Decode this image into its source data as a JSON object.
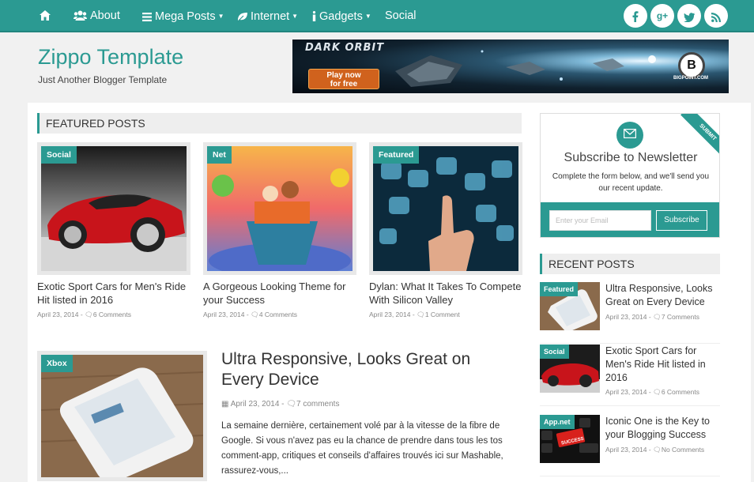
{
  "nav": {
    "items": [
      {
        "label": "About",
        "icon": "users-icon"
      },
      {
        "label": "Mega Posts",
        "icon": "list-icon"
      },
      {
        "label": "Internet",
        "icon": "leaf-icon"
      },
      {
        "label": "Gadgets",
        "icon": "info-icon"
      },
      {
        "label": "Social",
        "icon": ""
      }
    ],
    "social": [
      "facebook-icon",
      "google-plus-icon",
      "twitter-icon",
      "rss-icon"
    ]
  },
  "header": {
    "title": "Zippo Template",
    "tagline": "Just Another Blogger Template"
  },
  "banner": {
    "brand": "DARK ORBIT",
    "cta_line1": "Play now",
    "cta_line2": "for free",
    "sponsor": "BIGPOINT.COM"
  },
  "featured": {
    "heading": "FEATURED POSTS",
    "posts": [
      {
        "badge": "Social",
        "title": "Exotic Sport Cars for Men's Ride Hit listed in 2016",
        "date": "April 23, 2014",
        "comments": "6 Comments"
      },
      {
        "badge": "Net",
        "title": "A Gorgeous Looking Theme for your Success",
        "date": "April 23, 2014",
        "comments": "4 Comments"
      },
      {
        "badge": "Featured",
        "title": "Dylan: What It Takes To Compete With Silicon Valley",
        "date": "April 23, 2014",
        "comments": "1 Comment"
      }
    ]
  },
  "main_post": {
    "badge": "Xbox",
    "title": "Ultra Responsive, Looks Great on Every Device",
    "date": "April 23, 2014",
    "comments": "7 comments",
    "excerpt": "La semaine dernière, certainement volé par à la vitesse de la fibre de Google. Si vous n'avez pas eu la chance de prendre dans tous les tos comment-app, critiques et conseils d'affaires trouvés ici sur Mashable, rassurez-vous,..."
  },
  "newsletter": {
    "ribbon": "SUBMIT",
    "title": "Subscribe to Newsletter",
    "text": "Complete the form below, and we'll send you our recent update.",
    "placeholder": "Enter your Email",
    "button": "Subscribe"
  },
  "recent": {
    "heading": "RECENT POSTS",
    "posts": [
      {
        "badge": "Featured",
        "title": "Ultra Responsive, Looks Great on Every Device",
        "date": "April 23, 2014",
        "comments": "7 Comments"
      },
      {
        "badge": "Social",
        "title": "Exotic Sport Cars for Men's Ride Hit listed in 2016",
        "date": "April 23, 2014",
        "comments": "6 Comments"
      },
      {
        "badge": "App.net",
        "title": "Iconic One is the Key to your Blogging Success",
        "date": "April 23, 2014",
        "comments": "No Comments",
        "img_text": "SUCCESS"
      }
    ]
  },
  "colors": {
    "accent": "#2b9a92",
    "text": "#333333",
    "muted": "#888888"
  }
}
